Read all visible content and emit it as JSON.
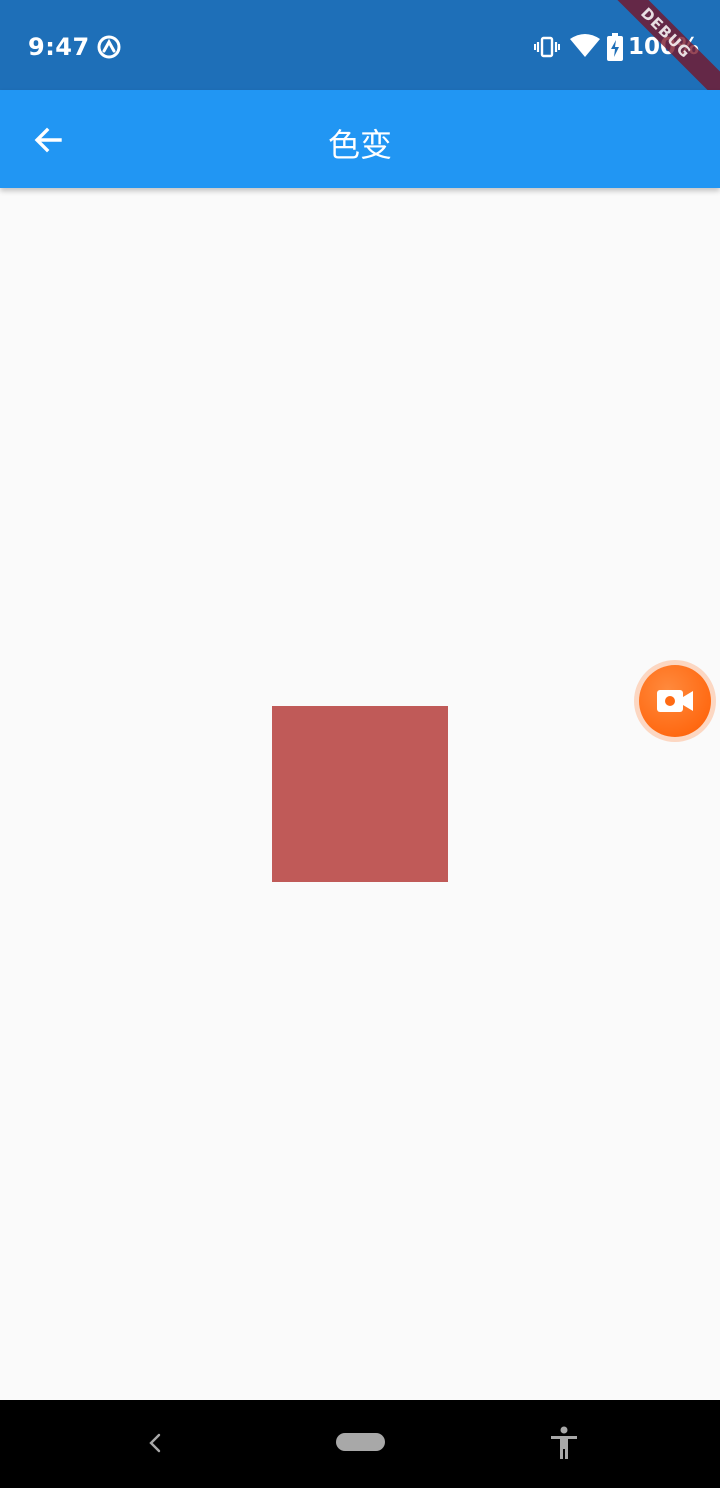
{
  "status_bar": {
    "time": "9:47",
    "battery": "100%",
    "debug_label": "DEBUG",
    "background_color": "#1e6fb8"
  },
  "app_bar": {
    "title": "色变",
    "back_icon": "arrow-back-icon",
    "background_color": "#2196f3"
  },
  "content": {
    "box_color": "#c05a58",
    "background_color": "#fafafa"
  },
  "floating_button": {
    "icon": "video-camera-icon",
    "color": "#ff6a13"
  },
  "nav_bar": {
    "back_icon": "nav-back-icon",
    "home_icon": "nav-home-pill",
    "accessibility_icon": "accessibility-icon"
  }
}
